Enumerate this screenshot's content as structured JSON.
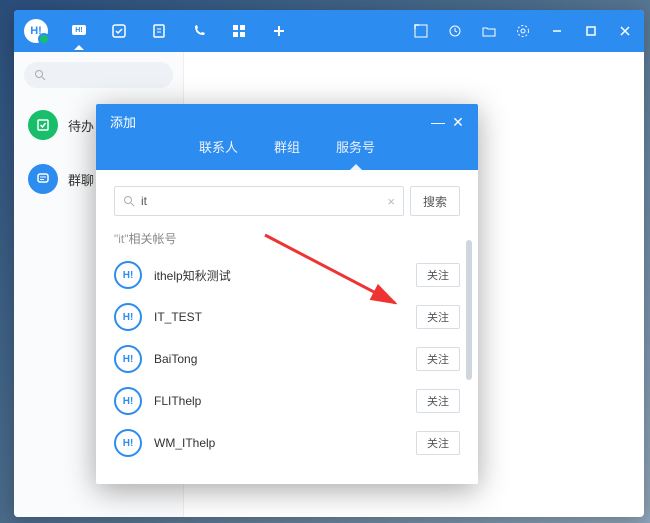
{
  "app": {
    "logo": "H!"
  },
  "sidebar": {
    "items": [
      {
        "label": "待办"
      },
      {
        "label": "群聊"
      }
    ]
  },
  "dialog": {
    "title": "添加",
    "tabs": [
      {
        "label": "联系人"
      },
      {
        "label": "群组"
      },
      {
        "label": "服务号"
      }
    ],
    "search_value": "it",
    "search_button": "搜索",
    "hint_prefix": "\"it\"",
    "hint_suffix": "相关帐号",
    "follow_label": "关注",
    "avatar_text": "H!",
    "results": [
      {
        "name": "ithelp知秋测试"
      },
      {
        "name": "IT_TEST"
      },
      {
        "name": "BaiTong"
      },
      {
        "name": "FLIThelp"
      },
      {
        "name": "WM_IThelp"
      }
    ]
  }
}
